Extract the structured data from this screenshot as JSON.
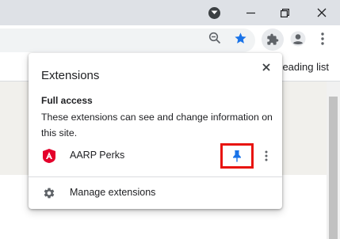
{
  "toolbar": {
    "reading_list_label": "Reading list"
  },
  "popup": {
    "title": "Extensions",
    "section_title": "Full access",
    "section_description": "These extensions can see and change information on this site.",
    "extensions": [
      {
        "name": "AARP Perks",
        "icon": "aarp-icon",
        "pinned": true
      }
    ],
    "manage_label": "Manage extensions"
  },
  "colors": {
    "titlebar": "#dee1e6",
    "omnibox": "#f1f3f4",
    "pin_blue": "#1a73e8",
    "highlight_red": "#e8140f",
    "aarp_red": "#e4002b",
    "page_band": "#f1f0ec"
  }
}
